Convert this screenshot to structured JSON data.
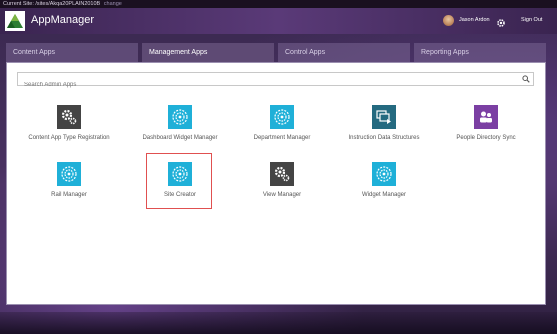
{
  "site_bar": {
    "label": "Current Site: /sites/Akqa20PLAIN2010B",
    "change_link": "change"
  },
  "header": {
    "title": "AppManager",
    "user_name": "Jason Ardon",
    "settings_icon": "gear-icon",
    "sign_out": "Sign Out"
  },
  "tabs": [
    {
      "label": "Content Apps",
      "active": false
    },
    {
      "label": "Management Apps",
      "active": true
    },
    {
      "label": "Control Apps",
      "active": false
    },
    {
      "label": "Reporting Apps",
      "active": false
    }
  ],
  "search": {
    "placeholder": "Search Admin Apps",
    "value": ""
  },
  "apps": [
    {
      "label": "Content App Type Registration",
      "icon": "gears-icon",
      "color": "#444444"
    },
    {
      "label": "Dashboard Widget Manager",
      "icon": "globe-icon",
      "color": "#1fb0d8"
    },
    {
      "label": "Department Manager",
      "icon": "globe-icon",
      "color": "#1fb0d8"
    },
    {
      "label": "Instruction Data Structures",
      "icon": "windows-icon",
      "color": "#246a80"
    },
    {
      "label": "People Directory Sync",
      "icon": "people-icon",
      "color": "#7b3fa3"
    },
    {
      "label": "Rail Manager",
      "icon": "globe-icon",
      "color": "#1fb0d8"
    },
    {
      "label": "Site Creator",
      "icon": "globe-icon",
      "color": "#1fb0d8",
      "highlighted": true
    },
    {
      "label": "View Manager",
      "icon": "gears-icon",
      "color": "#444444"
    },
    {
      "label": "Widget Manager",
      "icon": "globe-icon",
      "color": "#1fb0d8"
    }
  ]
}
